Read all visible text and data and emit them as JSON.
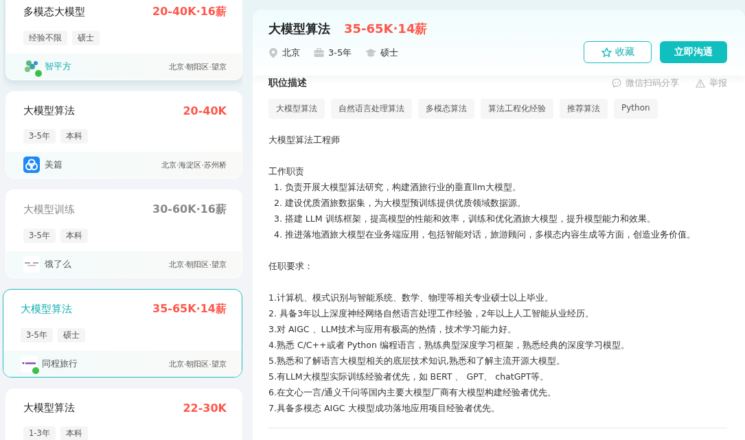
{
  "job_list": [
    {
      "title": "多模态大模型",
      "salary": "20-40K·16薪",
      "tags": [
        "经验不限",
        "硕士"
      ],
      "company": "智平方",
      "location": "北京·朝阳区·望京",
      "online": true,
      "hovered": true,
      "visited": false,
      "selected": false
    },
    {
      "title": "大模型算法",
      "salary": "20-40K",
      "tags": [
        "3-5年",
        "本科"
      ],
      "company": "美篇",
      "location": "北京·海淀区·苏州桥",
      "online": false,
      "hovered": false,
      "visited": false,
      "selected": false
    },
    {
      "title": "大模型训练",
      "salary": "30-60K·16薪",
      "tags": [
        "3-5年",
        "本科"
      ],
      "company": "饿了么",
      "location": "北京·朝阳区·望京",
      "online": false,
      "hovered": false,
      "visited": true,
      "selected": false
    },
    {
      "title": "大模型算法",
      "salary": "35-65K·14薪",
      "tags": [
        "3-5年",
        "硕士"
      ],
      "company": "同程旅行",
      "location": "北京·朝阳区·望京",
      "online": true,
      "hovered": false,
      "visited": false,
      "selected": true
    },
    {
      "title": "大模型算法",
      "salary": "22-30K",
      "tags": [
        "1-3年",
        "本科"
      ],
      "hovered": false,
      "visited": false,
      "selected": false
    }
  ],
  "detail": {
    "title": "大模型算法",
    "salary": "35-65K·14薪",
    "meta": [
      {
        "kind": "location",
        "text": "北京"
      },
      {
        "kind": "experience",
        "text": "3-5年"
      },
      {
        "kind": "degree",
        "text": "硕士"
      }
    ],
    "buttons": [
      {
        "kind": "secondary",
        "label": "收藏"
      },
      {
        "kind": "primary",
        "label": "立即沟通"
      }
    ],
    "section_title": "职位描述",
    "share": "微信扫码分享",
    "report": "举报",
    "tags": [
      "大模型算法",
      "自然语言处理算法",
      "多模态算法",
      "算法工程化经验",
      "推荐算法",
      "Python"
    ],
    "description": [
      {
        "kind": "line",
        "text": "大模型算法工程师"
      },
      {
        "kind": "gap"
      },
      {
        "kind": "line",
        "text": "工作职责"
      },
      {
        "kind": "item",
        "text": "1.  负责开展大模型算法研究，构建酒旅行业的垂直llm大模型。"
      },
      {
        "kind": "item",
        "text": "2. 建设优质酒旅数据集，为大模型预训练提供优质领域数据源。"
      },
      {
        "kind": "item",
        "text": "3. 搭建 LLM 训练框架，提高模型的性能和效率，训练和优化酒旅大模型，提升模型能力和效果。"
      },
      {
        "kind": "item",
        "text": "4. 推进落地酒旅大模型在业务端应用，包括智能对话，旅游顾问，多模态内容生成等方面，创造业务价值。"
      },
      {
        "kind": "gap"
      },
      {
        "kind": "line",
        "text": "任职要求："
      },
      {
        "kind": "gap"
      },
      {
        "kind": "line",
        "text": "1.计算机、模式识别与智能系统、数学、物理等相关专业硕士以上毕业。"
      },
      {
        "kind": "line",
        "text": "2. 具备3年以上深度神经网络自然语言处理工作经验，2年以上人工智能从业经历。"
      },
      {
        "kind": "line",
        "text": "3.对 AIGC 、LLM技术与应用有极高的热情，技术学习能力好。"
      },
      {
        "kind": "line",
        "text": "4.熟悉 C/C++或者 Python 编程语言，熟练典型深度学习框架，熟悉经典的深度学习模型。"
      },
      {
        "kind": "line",
        "text": "5.熟悉和了解语言大模型相关的底层技术知识,熟悉和了解主流开源大模型。"
      },
      {
        "kind": "line",
        "text": "5.有LLM大模型实际训练经验者优先，如 BERT 、 GPT、 chatGPT等。"
      },
      {
        "kind": "line",
        "text": "6.在文心一言/通义千问等国内主要大模型厂商有大模型构建经验者优先。"
      },
      {
        "kind": "line",
        "text": "7.具备多模态 AIGC 大模型成功落地应用项目经验者优先。"
      }
    ]
  }
}
